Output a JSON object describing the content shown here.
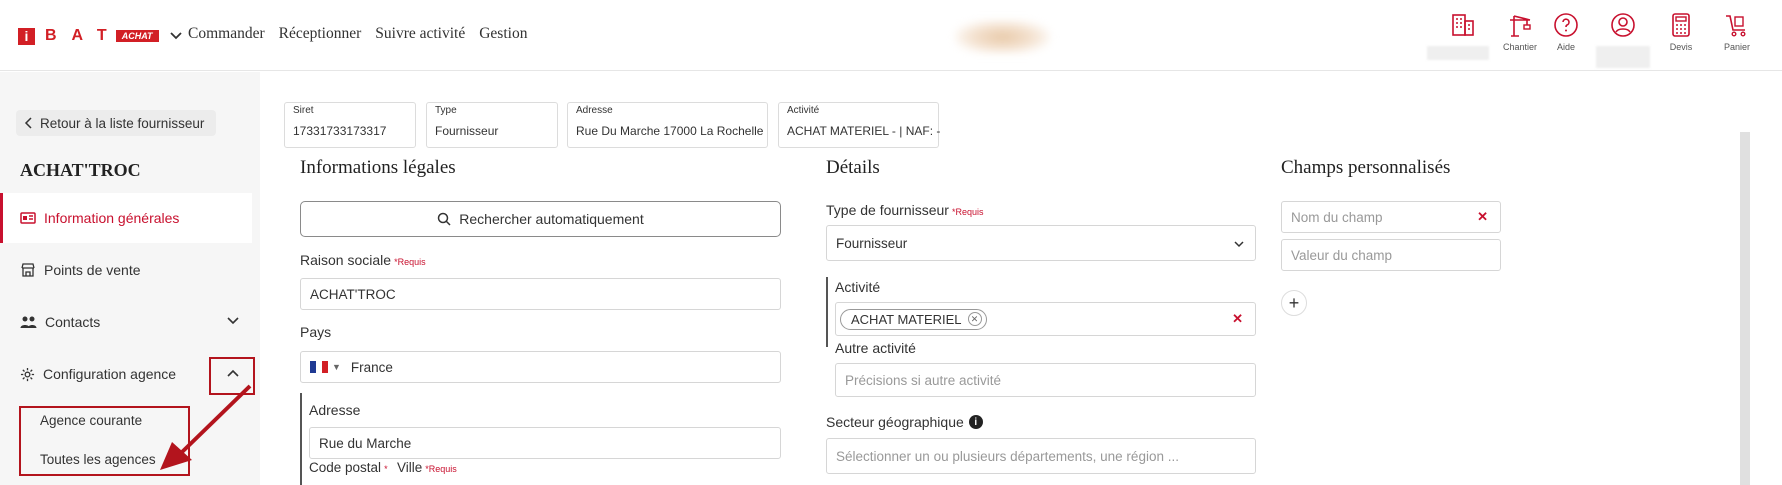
{
  "header": {
    "brand": "BAT",
    "brand_badge": "ACHAT",
    "nav": [
      "Commander",
      "Réceptionner",
      "Suivre activité",
      "Gestion"
    ],
    "tools": [
      {
        "icon": "building-icon",
        "label": ""
      },
      {
        "icon": "crane-icon",
        "label": "Chantier"
      },
      {
        "icon": "help-icon",
        "label": "Aide"
      },
      {
        "icon": "user-icon",
        "label": ""
      },
      {
        "icon": "calculator-icon",
        "label": "Devis"
      },
      {
        "icon": "cart-icon",
        "label": "Panier"
      }
    ],
    "accent": "#d21f25"
  },
  "sidebar": {
    "back_label": "Retour à la liste fournisseur",
    "supplier_name": "ACHAT'TROC",
    "items": [
      {
        "label": "Information générales",
        "icon": "id-card-icon",
        "active": true
      },
      {
        "label": "Points de vente",
        "icon": "store-icon"
      },
      {
        "label": "Contacts",
        "icon": "contacts-icon"
      },
      {
        "label": "Configuration agence",
        "icon": "gear-icon"
      }
    ],
    "sub_items": [
      "Agence courante",
      "Toutes les agences"
    ]
  },
  "summary": [
    {
      "key": "Siret",
      "value": "17331733173317"
    },
    {
      "key": "Type",
      "value": "Fournisseur"
    },
    {
      "key": "Adresse",
      "value": "Rue Du Marche 17000 La Rochelle"
    },
    {
      "key": "Activité",
      "value": "ACHAT MATERIEL - | NAF: -"
    }
  ],
  "legal": {
    "title": "Informations légales",
    "search_label": "Rechercher automatiquement",
    "raison_label": "Raison sociale",
    "raison_value": "ACHAT'TROC",
    "required": "*Requis",
    "pays_label": "Pays",
    "pays_value": "France",
    "adresse_label": "Adresse",
    "adresse_value": "Rue du Marche",
    "cp_label": "Code postal",
    "ville_label": "Ville"
  },
  "details": {
    "title": "Détails",
    "type_label": "Type de fournisseur",
    "type_value": "Fournisseur",
    "activite_label": "Activité",
    "activite_chip": "ACHAT MATERIEL",
    "autre_label": "Autre activité",
    "autre_placeholder": "Précisions si autre activité",
    "secteur_label": "Secteur géographique",
    "secteur_placeholder": "Sélectionner un ou plusieurs départements, une région ..."
  },
  "custom": {
    "title": "Champs personnalisés",
    "name_placeholder": "Nom du champ",
    "value_placeholder": "Valeur du champ"
  }
}
